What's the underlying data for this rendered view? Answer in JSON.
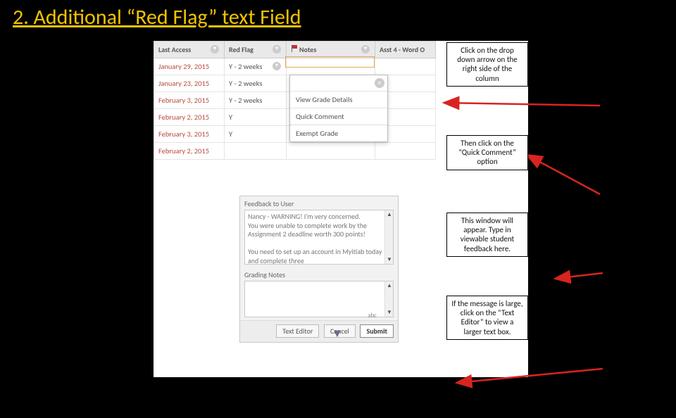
{
  "slide": {
    "title": "2. Additional “Red Flag” text Field"
  },
  "table": {
    "headers": {
      "c1": "Last Access",
      "c2": "Red Flag",
      "c3": "Notes",
      "c4": "Asst 4 - Word O"
    },
    "rows": [
      {
        "date": "January 29, 2015",
        "flag": "Y - 2 weeks"
      },
      {
        "date": "January 23, 2015",
        "flag": "Y - 2 weeks"
      },
      {
        "date": "February 3, 2015",
        "flag": "Y - 2 weeks"
      },
      {
        "date": "February 2, 2015",
        "flag": "Y"
      },
      {
        "date": "February 3, 2015",
        "flag": "Y"
      },
      {
        "date": "February 2, 2015",
        "flag": ""
      }
    ]
  },
  "menu": {
    "item1": "View Grade Details",
    "item2": "Quick Comment",
    "item3": "Exempt Grade"
  },
  "feedback": {
    "label1": "Feedback to User",
    "body": "Nancy - WARNING! I'm very concerned.\nYou were unable to complete work by the Assignment 2 deadline worth 300 points!\n\nYou need to set up an account in Myitlab today and complete three",
    "label2": "Grading Notes",
    "abc": "abc",
    "btn1": "Text Editor",
    "btn2": "Cancel",
    "btn3": "Submit"
  },
  "tips": {
    "t1": "Click on the drop down arrow on the right side of the column",
    "t2": "Then click on the “Quick Comment” option",
    "t3": "This window will appear. Type in viewable student feedback here.",
    "t4": "If the message is large, click on the “Text Editor” to view a larger text box."
  }
}
